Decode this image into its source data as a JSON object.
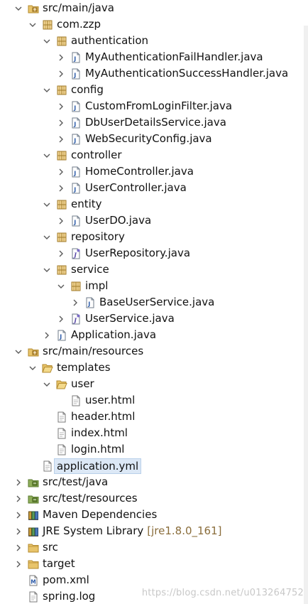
{
  "tree": [
    {
      "label": "src/main/java",
      "icon": "source-folder-icon",
      "arrow": "expanded",
      "depth": 0
    },
    {
      "label": "com.zzp",
      "icon": "package-icon",
      "arrow": "expanded",
      "depth": 1
    },
    {
      "label": "authentication",
      "icon": "package-icon",
      "arrow": "expanded",
      "depth": 2
    },
    {
      "label": "MyAuthenticationFailHandler.java",
      "icon": "java-file-icon",
      "arrow": "collapsed",
      "depth": 3
    },
    {
      "label": "MyAuthenticationSuccessHandler.java",
      "icon": "java-file-icon",
      "arrow": "collapsed",
      "depth": 3
    },
    {
      "label": "config",
      "icon": "package-icon",
      "arrow": "expanded",
      "depth": 2
    },
    {
      "label": "CustomFromLoginFilter.java",
      "icon": "java-file-icon",
      "arrow": "collapsed",
      "depth": 3
    },
    {
      "label": "DbUserDetailsService.java",
      "icon": "java-file-icon",
      "arrow": "collapsed",
      "depth": 3
    },
    {
      "label": "WebSecurityConfig.java",
      "icon": "java-file-icon",
      "arrow": "collapsed",
      "depth": 3
    },
    {
      "label": "controller",
      "icon": "package-icon",
      "arrow": "expanded",
      "depth": 2
    },
    {
      "label": "HomeController.java",
      "icon": "java-file-icon",
      "arrow": "collapsed",
      "depth": 3
    },
    {
      "label": "UserController.java",
      "icon": "java-file-icon",
      "arrow": "collapsed",
      "depth": 3
    },
    {
      "label": "entity",
      "icon": "package-icon",
      "arrow": "expanded",
      "depth": 2
    },
    {
      "label": "UserDO.java",
      "icon": "java-file-icon",
      "arrow": "collapsed",
      "depth": 3
    },
    {
      "label": "repository",
      "icon": "package-icon",
      "arrow": "expanded",
      "depth": 2
    },
    {
      "label": "UserRepository.java",
      "icon": "java-interface-icon",
      "arrow": "collapsed",
      "depth": 3
    },
    {
      "label": "service",
      "icon": "package-icon",
      "arrow": "expanded",
      "depth": 2
    },
    {
      "label": "impl",
      "icon": "package-icon",
      "arrow": "expanded",
      "depth": 3
    },
    {
      "label": "BaseUserService.java",
      "icon": "java-file-icon",
      "arrow": "collapsed",
      "depth": 4
    },
    {
      "label": "UserService.java",
      "icon": "java-interface-icon",
      "arrow": "collapsed",
      "depth": 3
    },
    {
      "label": "Application.java",
      "icon": "java-file-icon",
      "arrow": "collapsed",
      "depth": 2
    },
    {
      "label": "src/main/resources",
      "icon": "source-folder-icon",
      "arrow": "expanded",
      "depth": 0
    },
    {
      "label": "templates",
      "icon": "open-folder-icon",
      "arrow": "expanded",
      "depth": 1
    },
    {
      "label": "user",
      "icon": "open-folder-icon",
      "arrow": "expanded",
      "depth": 2
    },
    {
      "label": "user.html",
      "icon": "file-icon",
      "arrow": "none",
      "depth": 3
    },
    {
      "label": "header.html",
      "icon": "file-icon",
      "arrow": "none",
      "depth": 2
    },
    {
      "label": "index.html",
      "icon": "file-icon",
      "arrow": "none",
      "depth": 2
    },
    {
      "label": "login.html",
      "icon": "file-icon",
      "arrow": "none",
      "depth": 2
    },
    {
      "label": "application.yml",
      "icon": "file-icon",
      "arrow": "none",
      "depth": 1,
      "selected": true
    },
    {
      "label": "src/test/java",
      "icon": "test-source-folder-icon",
      "arrow": "collapsed",
      "depth": 0
    },
    {
      "label": "src/test/resources",
      "icon": "test-source-folder-icon",
      "arrow": "collapsed",
      "depth": 0
    },
    {
      "label": "Maven Dependencies",
      "icon": "library-icon",
      "arrow": "collapsed",
      "depth": 0
    },
    {
      "label": "JRE System Library",
      "decoration": "[jre1.8.0_161]",
      "icon": "library-icon",
      "arrow": "collapsed",
      "depth": 0
    },
    {
      "label": "src",
      "icon": "folder-icon",
      "arrow": "collapsed",
      "depth": 0
    },
    {
      "label": "target",
      "icon": "folder-icon",
      "arrow": "collapsed",
      "depth": 0
    },
    {
      "label": "pom.xml",
      "icon": "maven-pom-icon",
      "arrow": "none",
      "depth": 0
    },
    {
      "label": "spring.log",
      "icon": "file-icon",
      "arrow": "none",
      "depth": 0
    }
  ],
  "watermark": "https://blog.csdn.net/u013264752"
}
